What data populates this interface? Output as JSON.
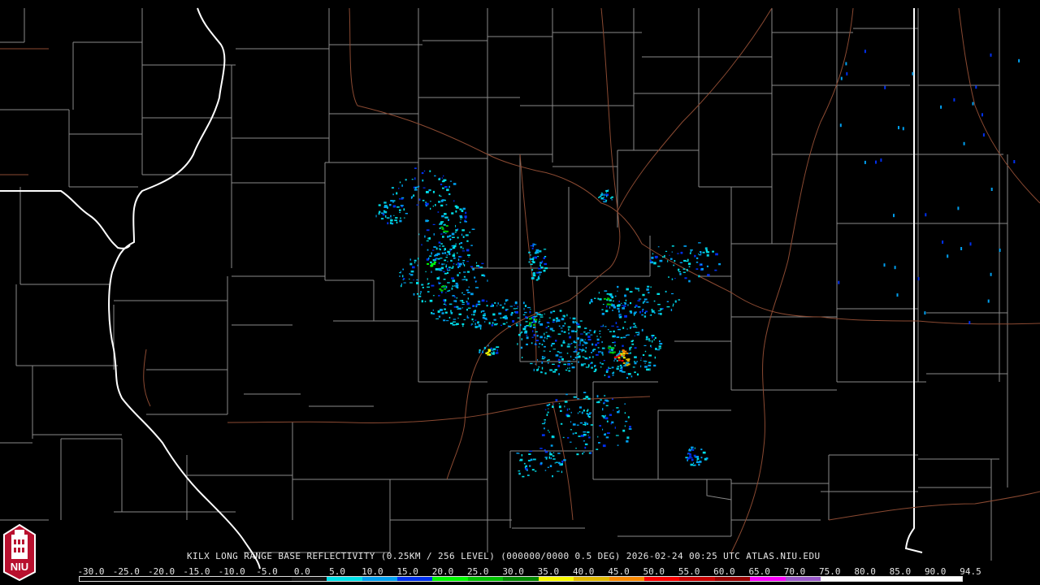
{
  "caption": "KILX LONG RANGE BASE REFLECTIVITY (0.25KM / 256 LEVEL) (000000/0000 0.5 DEG) 2026-02-24 00:25 UTC  ATLAS.NIU.EDU",
  "logo": {
    "text": "NIU",
    "icon": "niu-tower-logo"
  },
  "colors": {
    "background": "#000000",
    "county_lines": "#8a8a8a",
    "state_lines": "#ffffff",
    "highways": "#8b4a32"
  },
  "color_scale": {
    "labels": [
      "-30.0",
      "-25.0",
      "-20.0",
      "-15.0",
      "-10.0",
      "-5.0",
      "0.0",
      "5.0",
      "10.0",
      "15.0",
      "20.0",
      "25.0",
      "30.0",
      "35.0",
      "40.0",
      "45.0",
      "50.0",
      "55.0",
      "60.0",
      "65.0",
      "70.0",
      "75.0",
      "80.0",
      "85.0",
      "90.0",
      "94.5"
    ],
    "colors": [
      "#000000",
      "#000000",
      "#000000",
      "#000000",
      "#000000",
      "#000000",
      "#111111",
      "#00e0e8",
      "#00a0f0",
      "#0030f0",
      "#00f800",
      "#00c000",
      "#008800",
      "#f8f800",
      "#e0b800",
      "#f88800",
      "#f80000",
      "#c80000",
      "#980000",
      "#f800f8",
      "#9858c8",
      "#ffffff",
      "#ffffff",
      "#ffffff",
      "#ffffff"
    ]
  }
}
